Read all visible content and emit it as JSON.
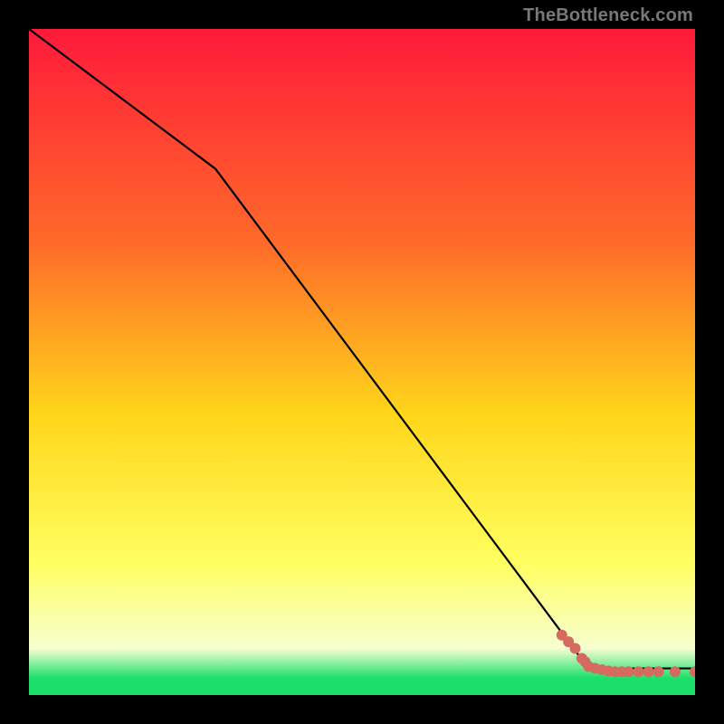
{
  "attribution": "TheBottleneck.com",
  "colors": {
    "gradient_top": "#ff1a3a",
    "gradient_mid_upper": "#ff6a2a",
    "gradient_mid": "#ffd61a",
    "gradient_mid_lower": "#ffff60",
    "gradient_pale": "#f7ffd0",
    "gradient_green": "#1adf6a",
    "frame": "#000000",
    "line": "#000000",
    "marker": "#d56a60"
  },
  "chart_data": {
    "type": "line",
    "title": "",
    "xlabel": "",
    "ylabel": "",
    "xlim": [
      0,
      100
    ],
    "ylim": [
      0,
      100
    ],
    "grid": false,
    "series": [
      {
        "name": "bottleneck-curve",
        "type": "line",
        "x": [
          0,
          28,
          84,
          100
        ],
        "y": [
          100,
          79,
          4,
          4
        ]
      },
      {
        "name": "data-points",
        "type": "scatter",
        "x": [
          80,
          81,
          82,
          83,
          83.5,
          84,
          85,
          86,
          87,
          88,
          89,
          90,
          91.5,
          93,
          94.5,
          97,
          100
        ],
        "y": [
          9,
          8,
          7,
          5.5,
          5,
          4.3,
          4,
          3.8,
          3.6,
          3.5,
          3.5,
          3.5,
          3.5,
          3.5,
          3.5,
          3.5,
          3.5
        ]
      }
    ]
  }
}
